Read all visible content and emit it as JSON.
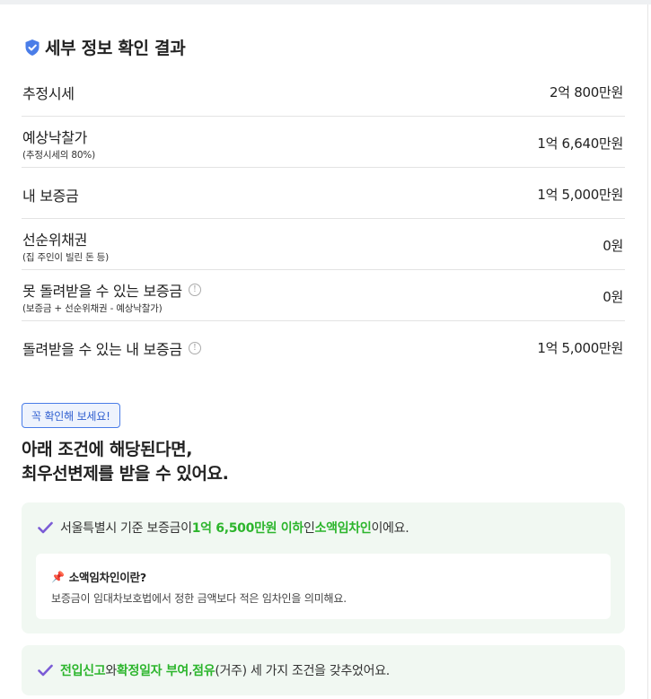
{
  "section": {
    "title": "세부 정보 확인 결과",
    "title_icon": "shield-check-icon",
    "accent": "#4a7de8"
  },
  "rows": [
    {
      "label": "추정시세",
      "sub": "",
      "value": "2억 800만원",
      "info": false
    },
    {
      "label": "예상낙찰가",
      "sub": "(추정시세의 80%)",
      "value": "1억 6,640만원",
      "info": false
    },
    {
      "label": "내 보증금",
      "sub": "",
      "value": "1억 5,000만원",
      "info": false
    },
    {
      "label": "선순위채권",
      "sub": "(집 주인이 빌린 돈 등)",
      "value": "0원",
      "info": false
    },
    {
      "label": "못 돌려받을 수 있는 보증금",
      "sub": "(보증금 + 선순위채권 - 예상낙찰가)",
      "value": "0원",
      "info": true
    },
    {
      "label": "돌려받을 수 있는 내 보증금",
      "sub": "",
      "value": "1억 5,000만원",
      "info": true
    }
  ],
  "info_glyph": "!",
  "tag": "꼭 확인해 보세요!",
  "headline": {
    "line1": "아래 조건에 해당된다면,",
    "line2": "최우선변제를 받을 수 있어요."
  },
  "condition1": {
    "pre": "서울특별시 기준 보증금이 ",
    "hl1": "1억 6,500만원 이하",
    "mid": "인 ",
    "hl2": "소액임차인",
    "post": "이에요.",
    "note_icon": "pushpin-icon",
    "note_title": "소액임차인이란?",
    "note_body": "보증금이 임대차보호법에서 정한 금액보다 적은 임차인을 의미해요."
  },
  "condition2": {
    "hl1": "전입신고",
    "t1": "와 ",
    "hl2": "확정일자 부여",
    "t2": ", ",
    "hl3": "점유",
    "post": "(거주) 세 가지 조건을 갖추었어요."
  },
  "colors": {
    "highlight": "#2cb52c",
    "check": "#7b5cd6",
    "condition_bg": "#f1f8f2",
    "tag_border": "#4a7de8"
  }
}
